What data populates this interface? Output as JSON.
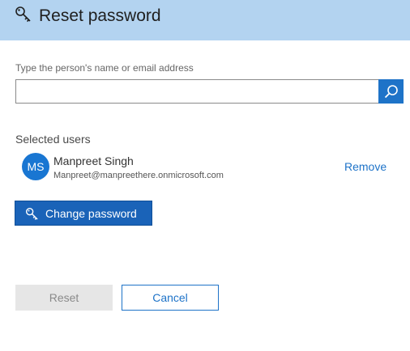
{
  "header": {
    "title": "Reset password",
    "icon": "key-icon",
    "background": "#b3d3f0"
  },
  "search": {
    "label": "Type the person's name or email address",
    "value": "",
    "placeholder": "",
    "button_icon": "search-icon"
  },
  "selected_users": {
    "heading": "Selected users",
    "users": [
      {
        "initials": "MS",
        "name": "Manpreet Singh",
        "email": "Manpreet@manpreethere.onmicrosoft.com",
        "remove_label": "Remove"
      }
    ]
  },
  "actions": {
    "change_password_label": "Change password",
    "change_password_icon": "key-icon",
    "reset_label": "Reset",
    "reset_enabled": false,
    "cancel_label": "Cancel"
  },
  "colors": {
    "accent": "#1e73c8",
    "primary_button": "#1a63b8",
    "avatar": "#1976d2"
  }
}
